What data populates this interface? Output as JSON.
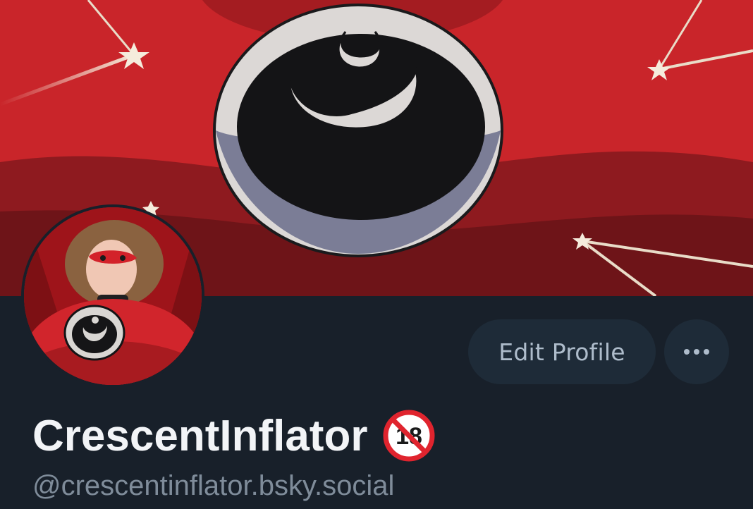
{
  "profile": {
    "display_name": "CrescentInflator",
    "handle": "@crescentinflator.bsky.social",
    "age_badge_icon": "no-under-18-icon",
    "age_badge_text": "18"
  },
  "actions": {
    "edit_label": "Edit Profile",
    "more_icon": "ellipsis-icon"
  },
  "colors": {
    "background": "#18202a",
    "button_bg": "#1e2b38",
    "button_text": "#aebccb",
    "name_text": "#f2f4f7",
    "handle_text": "#7f8c9a",
    "banner_red": "#c9252a"
  }
}
